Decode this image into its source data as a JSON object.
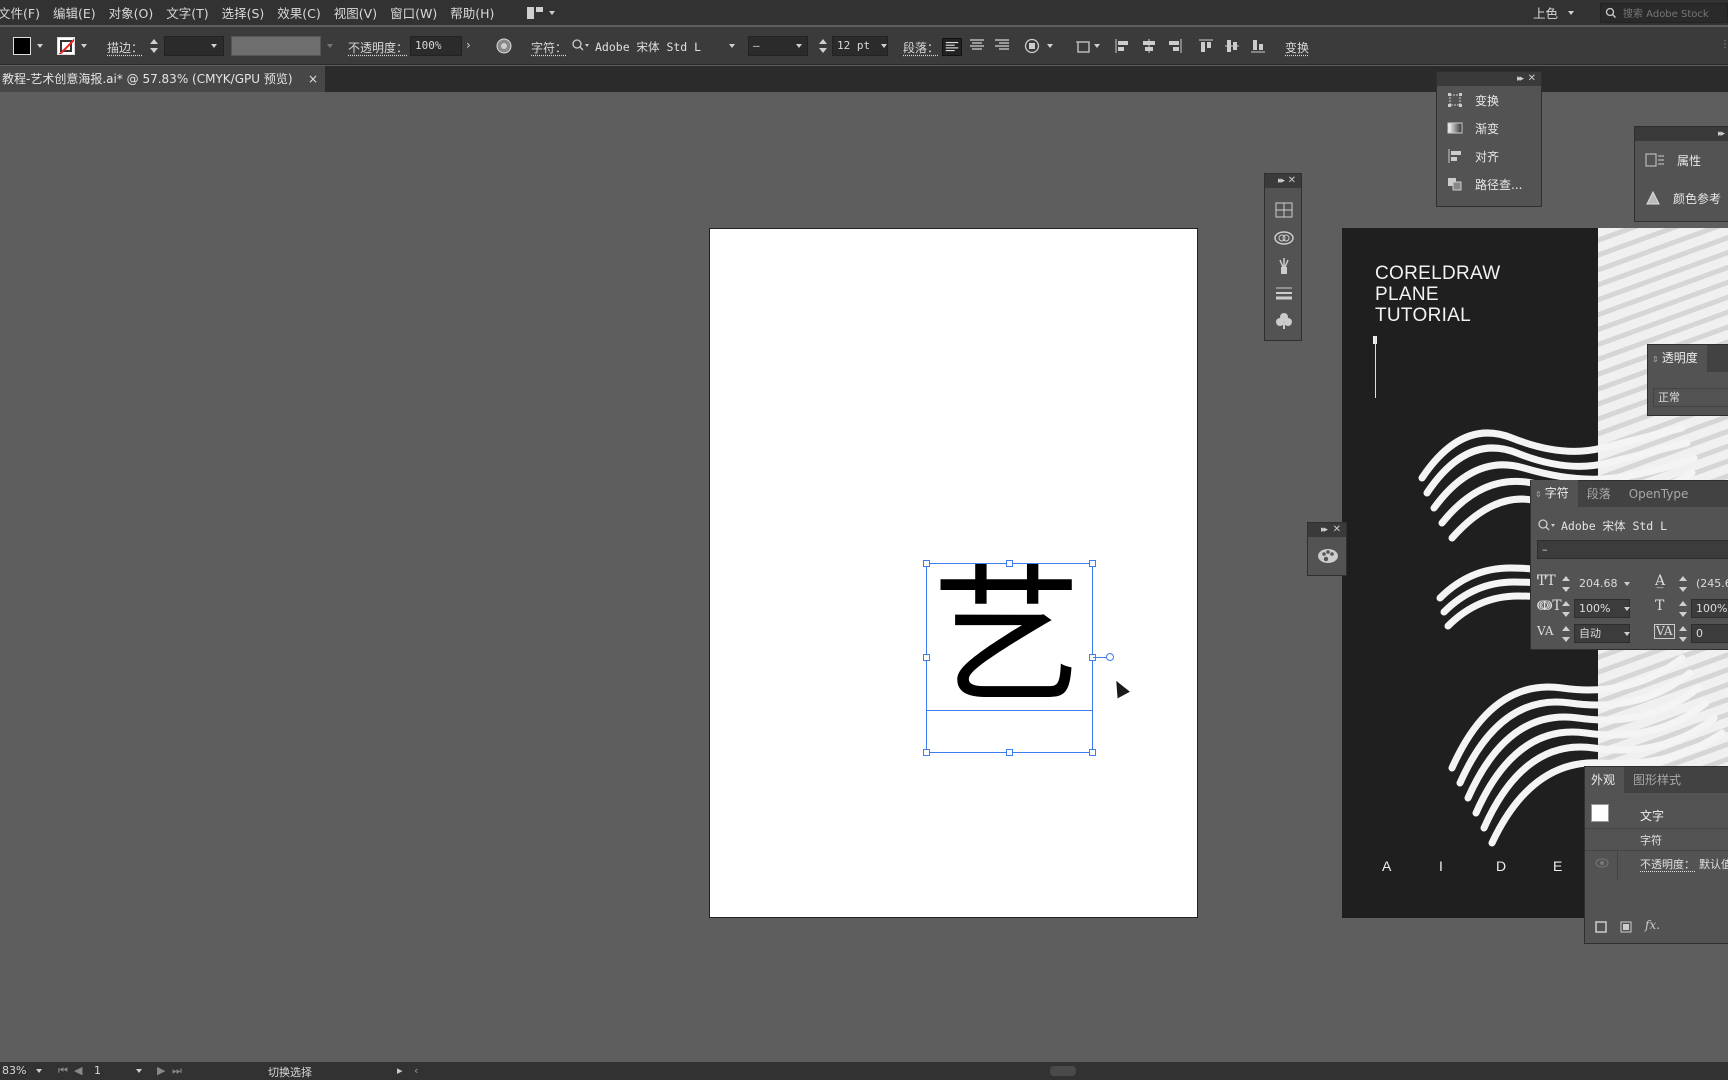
{
  "menubar": {
    "items": [
      "文件(F)",
      "编辑(E)",
      "对象(O)",
      "文字(T)",
      "选择(S)",
      "效果(C)",
      "视图(V)",
      "窗口(W)",
      "帮助(H)"
    ],
    "workspace": "上色",
    "search_placeholder": "搜索 Adobe Stock"
  },
  "control_bar": {
    "stroke_label": "描边：",
    "opacity_label": "不透明度：",
    "opacity_value": "100%",
    "character_label": "字符：",
    "font_family": "Adobe 宋体 Std L",
    "font_style": "–",
    "font_size": "12 pt",
    "paragraph_label": "段落：",
    "transform_label": "变换",
    "fill_color": "#000000"
  },
  "document_tab": {
    "title": "教程-艺术创意海报.ai* @ 57.83% (CMYK/GPU 预览)",
    "close": "×"
  },
  "canvas": {
    "glyph_text": "艺",
    "glyph_color": "#000000",
    "selection_color": "#3d7cf1"
  },
  "poster": {
    "title_lines": [
      "CORELDRAW",
      "PLANE",
      "TUTORIAL"
    ],
    "footer_letters": [
      "A",
      "I",
      "D",
      "E"
    ]
  },
  "panel_transform_group": {
    "items": [
      {
        "label": "变换",
        "icon": "transform-icon"
      },
      {
        "label": "渐变",
        "icon": "gradient-icon"
      },
      {
        "label": "对齐",
        "icon": "align-icon"
      },
      {
        "label": "路径查...",
        "icon": "pathfinder-icon"
      }
    ]
  },
  "panel_properties": {
    "items": [
      {
        "label": "属性",
        "icon": "properties-icon"
      },
      {
        "label": "颜色参考",
        "icon": "color-guide-icon"
      }
    ]
  },
  "panel_transparency": {
    "tab": "透明度",
    "blend_mode": "正常"
  },
  "panel_character": {
    "tabs": [
      "字符",
      "段落",
      "OpenType"
    ],
    "font_family": "Adobe 宋体 Std L",
    "font_style": "–",
    "font_size": "204.68",
    "leading": "(245.6",
    "vertical_scale": "100%",
    "horizontal_scale": "100%",
    "kerning": "自动",
    "tracking": "0"
  },
  "panel_appearance": {
    "tabs": [
      "外观",
      "图形样式"
    ],
    "object_label": "文字",
    "character_label": "字符",
    "opacity_label": "不透明度：",
    "opacity_value": "默认值"
  },
  "statusbar": {
    "zoom": "83%",
    "artboard_number": "1",
    "tool_status": "切换选择"
  }
}
